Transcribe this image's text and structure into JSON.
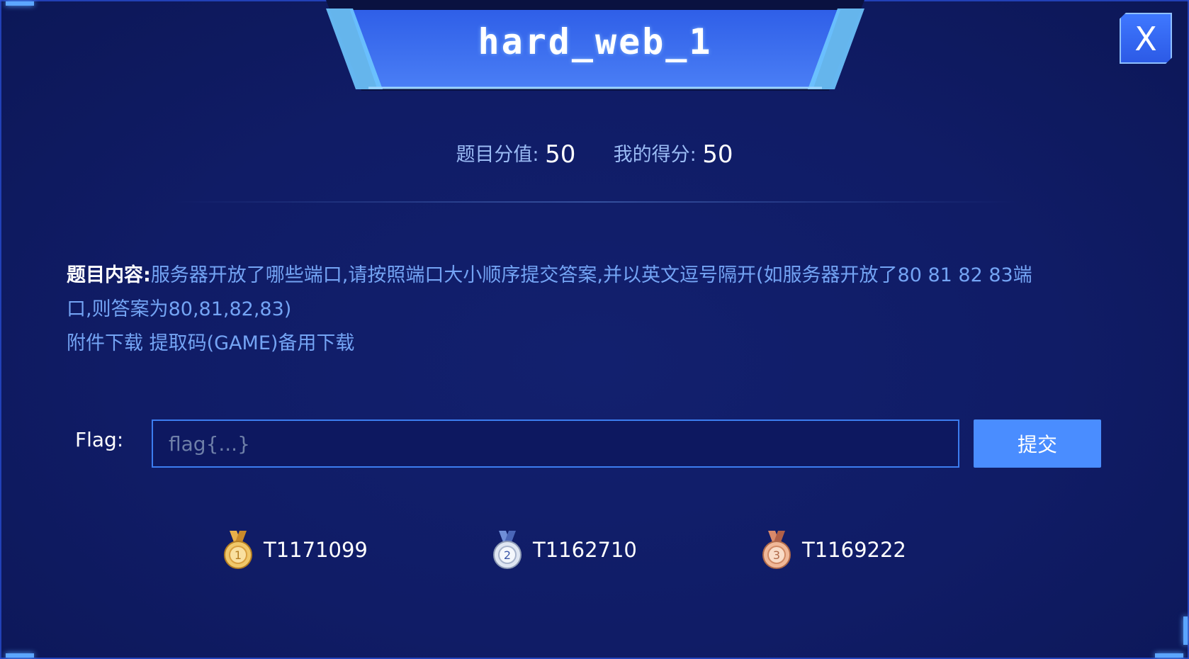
{
  "modal": {
    "title": "hard_web_1",
    "close_label": "X"
  },
  "score": {
    "value_label": "题目分值:",
    "value": "50",
    "my_label": "我的得分:",
    "my_value": "50"
  },
  "content": {
    "label": "题目内容:",
    "line1": "服务器开放了哪些端口,请按照端口大小顺序提交答案,并以英文逗号隔开(如服务器开放了80 81 82 83端",
    "line2": "口,则答案为80,81,82,83)",
    "attachment_link": "附件下载",
    "extract_code": "提取码(GAME)",
    "backup_link": "备用下载"
  },
  "flag": {
    "label": "Flag:",
    "placeholder": "flag{...}",
    "value": "",
    "submit_label": "提交"
  },
  "rankings": [
    {
      "rank": "1",
      "name": "T1171099",
      "color": "#e8b04a"
    },
    {
      "rank": "2",
      "name": "T1162710",
      "color": "#c9d3e6"
    },
    {
      "rank": "3",
      "name": "T1169222",
      "color": "#d9896a"
    }
  ],
  "colors": {
    "background": "#101c66",
    "accent": "#4a8dff",
    "link": "#74a4f4"
  }
}
